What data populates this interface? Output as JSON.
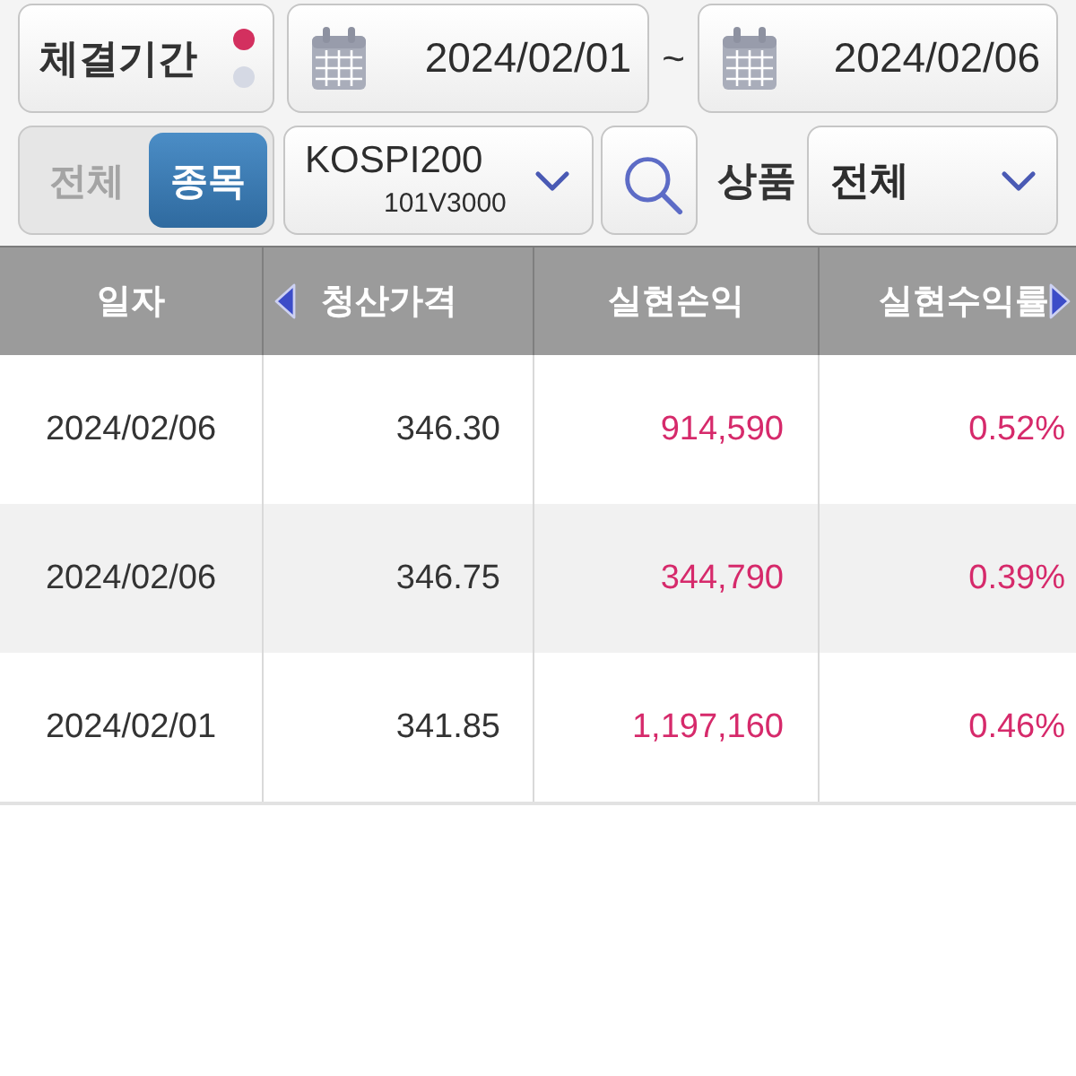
{
  "period_button": {
    "label": "체결기간",
    "indicator": [
      {
        "selected": true
      },
      {
        "selected": false
      }
    ]
  },
  "date_range": {
    "start": "2024/02/01",
    "separator": "~",
    "end": "2024/02/06"
  },
  "scope_toggle": [
    {
      "label": "전체",
      "selected": false
    },
    {
      "label": "종목",
      "selected": true
    }
  ],
  "symbol_dropdown": {
    "name": "KOSPI200",
    "code": "101V3000"
  },
  "product": {
    "label": "상품",
    "value": "전체"
  },
  "table": {
    "columns": [
      {
        "label": "일자",
        "kind": "date",
        "scroll_left": false,
        "scroll_right": false
      },
      {
        "label": "청산가격",
        "kind": "price",
        "scroll_left": true,
        "scroll_right": false
      },
      {
        "label": "실현손익",
        "kind": "profit",
        "scroll_left": false,
        "scroll_right": false
      },
      {
        "label": "실현수익률",
        "kind": "profit",
        "scroll_left": false,
        "scroll_right": true
      }
    ],
    "rows": [
      [
        "2024/02/06",
        "346.30",
        "914,590",
        "0.52%"
      ],
      [
        "2024/02/06",
        "346.75",
        "344,790",
        "0.39%"
      ],
      [
        "2024/02/01",
        "341.85",
        "1,197,160",
        "0.46%"
      ]
    ]
  }
}
